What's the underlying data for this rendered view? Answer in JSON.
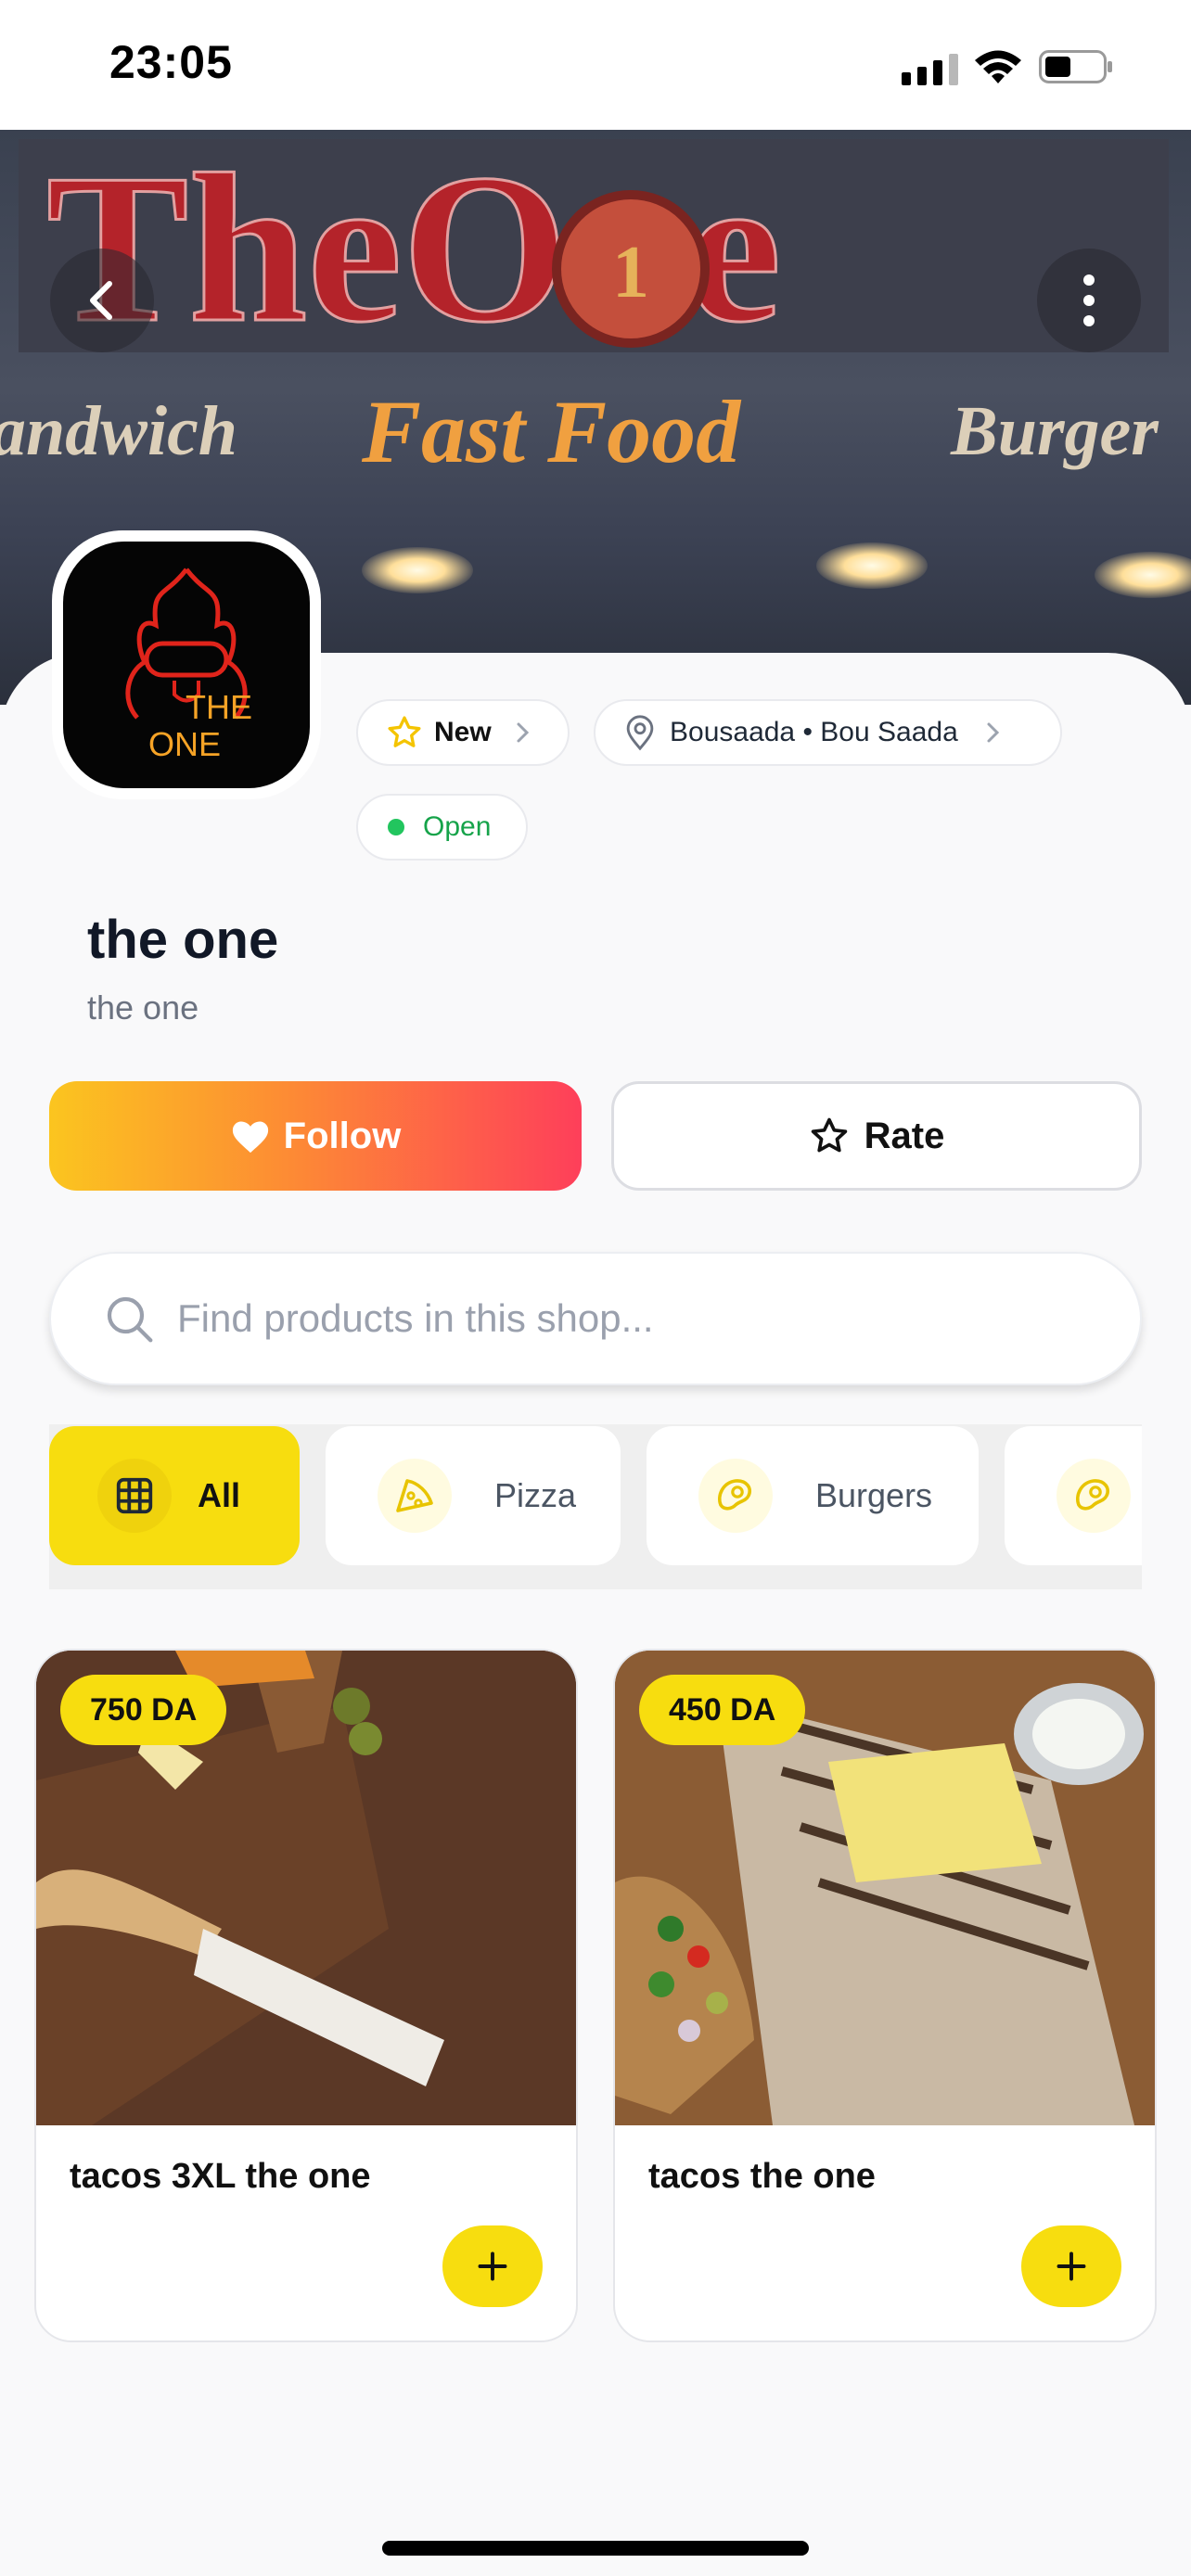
{
  "status_bar": {
    "time": "23:05"
  },
  "shop": {
    "name": "the one",
    "description": "the one",
    "logo_text_1": "THE",
    "logo_text_2": "ONE",
    "badge_new": "New",
    "location": "Bousaada • Bou Saada",
    "status": "Open",
    "cover_sign_line1": "TheOne",
    "cover_sign_line2_left": "andwich",
    "cover_sign_line2_mid": "Fast Food",
    "cover_sign_line2_right": "Burger"
  },
  "actions": {
    "follow_label": "Follow",
    "rate_label": "Rate"
  },
  "search": {
    "placeholder": "Find products in this shop..."
  },
  "categories": [
    {
      "label": "All",
      "icon": "grid-icon",
      "selected": true
    },
    {
      "label": "Pizza",
      "icon": "pizza-icon",
      "selected": false
    },
    {
      "label": "Burgers",
      "icon": "burger-icon",
      "selected": false
    }
  ],
  "products": [
    {
      "name": "tacos 3XL the one",
      "price": "750 DA"
    },
    {
      "name": "tacos the one",
      "price": "450 DA"
    }
  ],
  "colors": {
    "accent_yellow": "#f7dd0f",
    "follow_start": "#fbc51f",
    "follow_end": "#fe3f5a",
    "open_green": "#22c55e"
  }
}
